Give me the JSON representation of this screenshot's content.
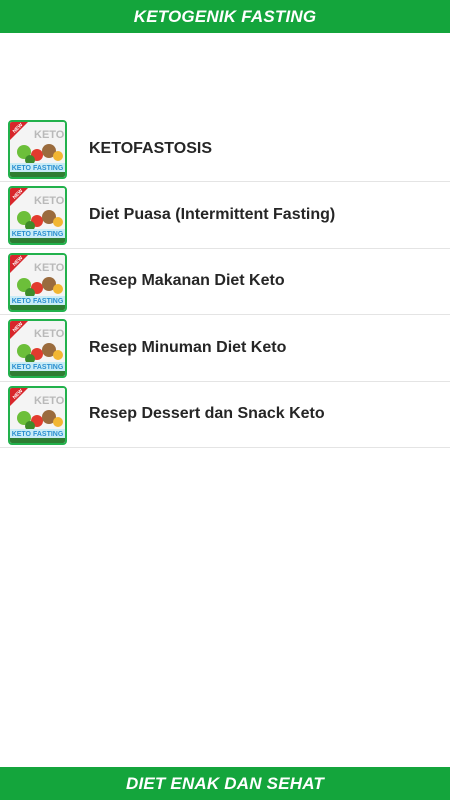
{
  "header": {
    "title": "KETOGENIK FASTING"
  },
  "footer": {
    "title": "DIET ENAK DAN SEHAT"
  },
  "thumbnail": {
    "badge": "NEW",
    "brand": "KETO",
    "banner": "KETO FASTING"
  },
  "menu": {
    "items": [
      {
        "label": "KETOFASTOSIS"
      },
      {
        "label": "Diet Puasa (Intermittent Fasting)"
      },
      {
        "label": "Resep Makanan Diet Keto"
      },
      {
        "label": "Resep Minuman Diet Keto"
      },
      {
        "label": "Resep Dessert dan Snack Keto"
      }
    ]
  },
  "colors": {
    "bar": "#14a53c",
    "thumb_border": "#22b14c",
    "badge": "#d8262b",
    "divider": "#e4e4e4"
  }
}
